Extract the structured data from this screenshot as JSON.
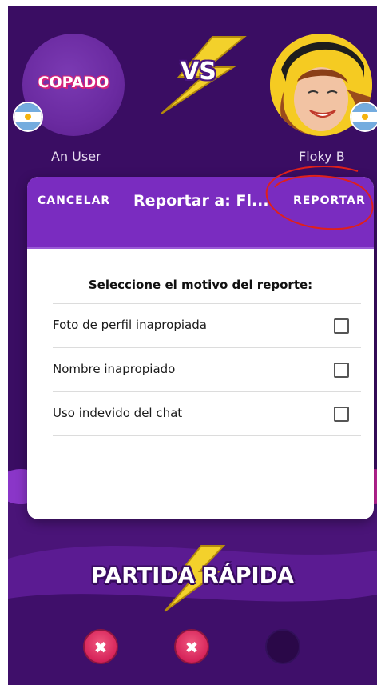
{
  "match": {
    "logo_text": "COPADO",
    "vs_label": "VS",
    "player_left_name": "An User",
    "player_right_name": "Floky B",
    "mode_title": "PARTIDA RÁPIDA"
  },
  "report_dialog": {
    "cancel_label": "CANCELAR",
    "title": "Reportar a: Fl...",
    "report_label": "REPORTAR",
    "subtitle": "Seleccione el motivo del reporte:",
    "reasons": [
      {
        "label": "Foto de perfil inapropiada",
        "checked": false
      },
      {
        "label": "Nombre inapropiado",
        "checked": false
      },
      {
        "label": "Uso indevido del chat",
        "checked": false
      }
    ]
  },
  "bottom_buttons": [
    {
      "icon": "close-icon",
      "glyph": "✖"
    },
    {
      "icon": "close-icon",
      "glyph": "✖"
    },
    {
      "icon": "empty-slot"
    }
  ],
  "colors": {
    "background": "#3a0d63",
    "header": "#7a2cc0",
    "accent_red": "#d6245a",
    "bolt_yellow": "#f3d12b",
    "annotation": "#e0201b"
  }
}
